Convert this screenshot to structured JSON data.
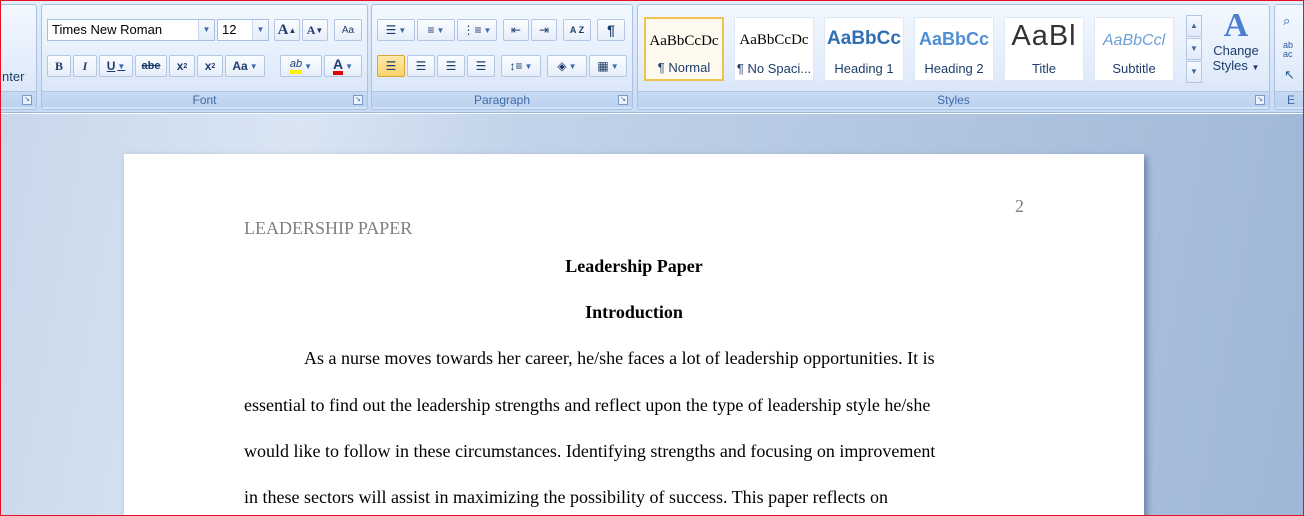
{
  "ribbon": {
    "clipboard": {
      "label_fragment": "nter"
    },
    "font": {
      "label": "Font",
      "name": "Times New Roman",
      "size": "12",
      "grow": "A",
      "shrink": "A",
      "clear_format": "Aa",
      "bold": "B",
      "italic": "I",
      "underline": "U",
      "strike": "abe",
      "subscript": "x",
      "superscript": "x",
      "change_case": "Aa",
      "highlight": "ab",
      "font_color": "A"
    },
    "paragraph": {
      "label": "Paragraph",
      "sort": "A Z",
      "pilcrow": "¶"
    },
    "styles": {
      "label": "Styles",
      "tiles": [
        {
          "sample": "AaBbCcDc",
          "name": "¶ Normal"
        },
        {
          "sample": "AaBbCcDc",
          "name": "¶ No Spaci..."
        },
        {
          "sample": "AaBbCc",
          "name": "Heading 1"
        },
        {
          "sample": "AaBbCc",
          "name": "Heading 2"
        },
        {
          "sample": "AaBl",
          "name": "Title"
        },
        {
          "sample": "AaBbCcl",
          "name": "Subtitle"
        }
      ],
      "change_styles": {
        "line1": "Change",
        "line2": "Styles"
      }
    },
    "editing": {
      "label_fragment": "E"
    }
  },
  "document": {
    "running_head": "LEADERSHIP PAPER",
    "page_number": "2",
    "title": "Leadership Paper",
    "heading": "Introduction",
    "lines": [
      "As a nurse moves towards her career, he/she faces a lot of leadership opportunities. It is",
      "essential to find out the leadership strengths and reflect upon the type of leadership style he/she",
      "would like to follow in these circumstances. Identifying strengths and focusing on improvement",
      "in these sectors will assist in maximizing the possibility of success. This paper reflects on"
    ]
  }
}
